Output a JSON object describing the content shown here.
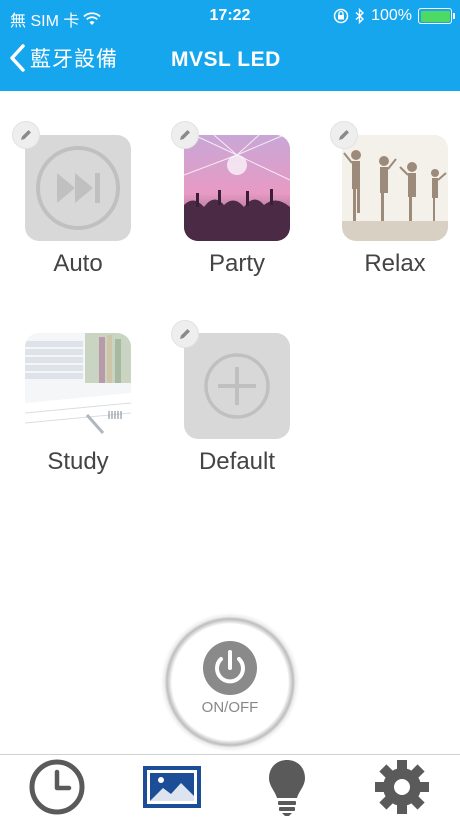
{
  "status_bar": {
    "carrier": "無 SIM 卡",
    "time": "17:22",
    "battery": "100%"
  },
  "nav": {
    "back_label": "藍牙設備",
    "title": "MVSL LED"
  },
  "scenes": [
    {
      "label": "Auto",
      "icon": "skip-forward-icon"
    },
    {
      "label": "Party",
      "icon": "party-crowd-image"
    },
    {
      "label": "Relax",
      "icon": "yoga-image"
    },
    {
      "label": "Study",
      "icon": "books-image"
    },
    {
      "label": "Default",
      "icon": "add-icon"
    }
  ],
  "power": {
    "label": "ON/OFF"
  },
  "tabs": [
    {
      "name": "clock-icon",
      "selected": false
    },
    {
      "name": "scene-image-icon",
      "selected": true
    },
    {
      "name": "bulb-icon",
      "selected": false
    },
    {
      "name": "gear-icon",
      "selected": false
    }
  ],
  "colors": {
    "header": "#16a6ee",
    "tab_selected": "#1b4e96",
    "tab_normal": "#5a5a5a"
  }
}
